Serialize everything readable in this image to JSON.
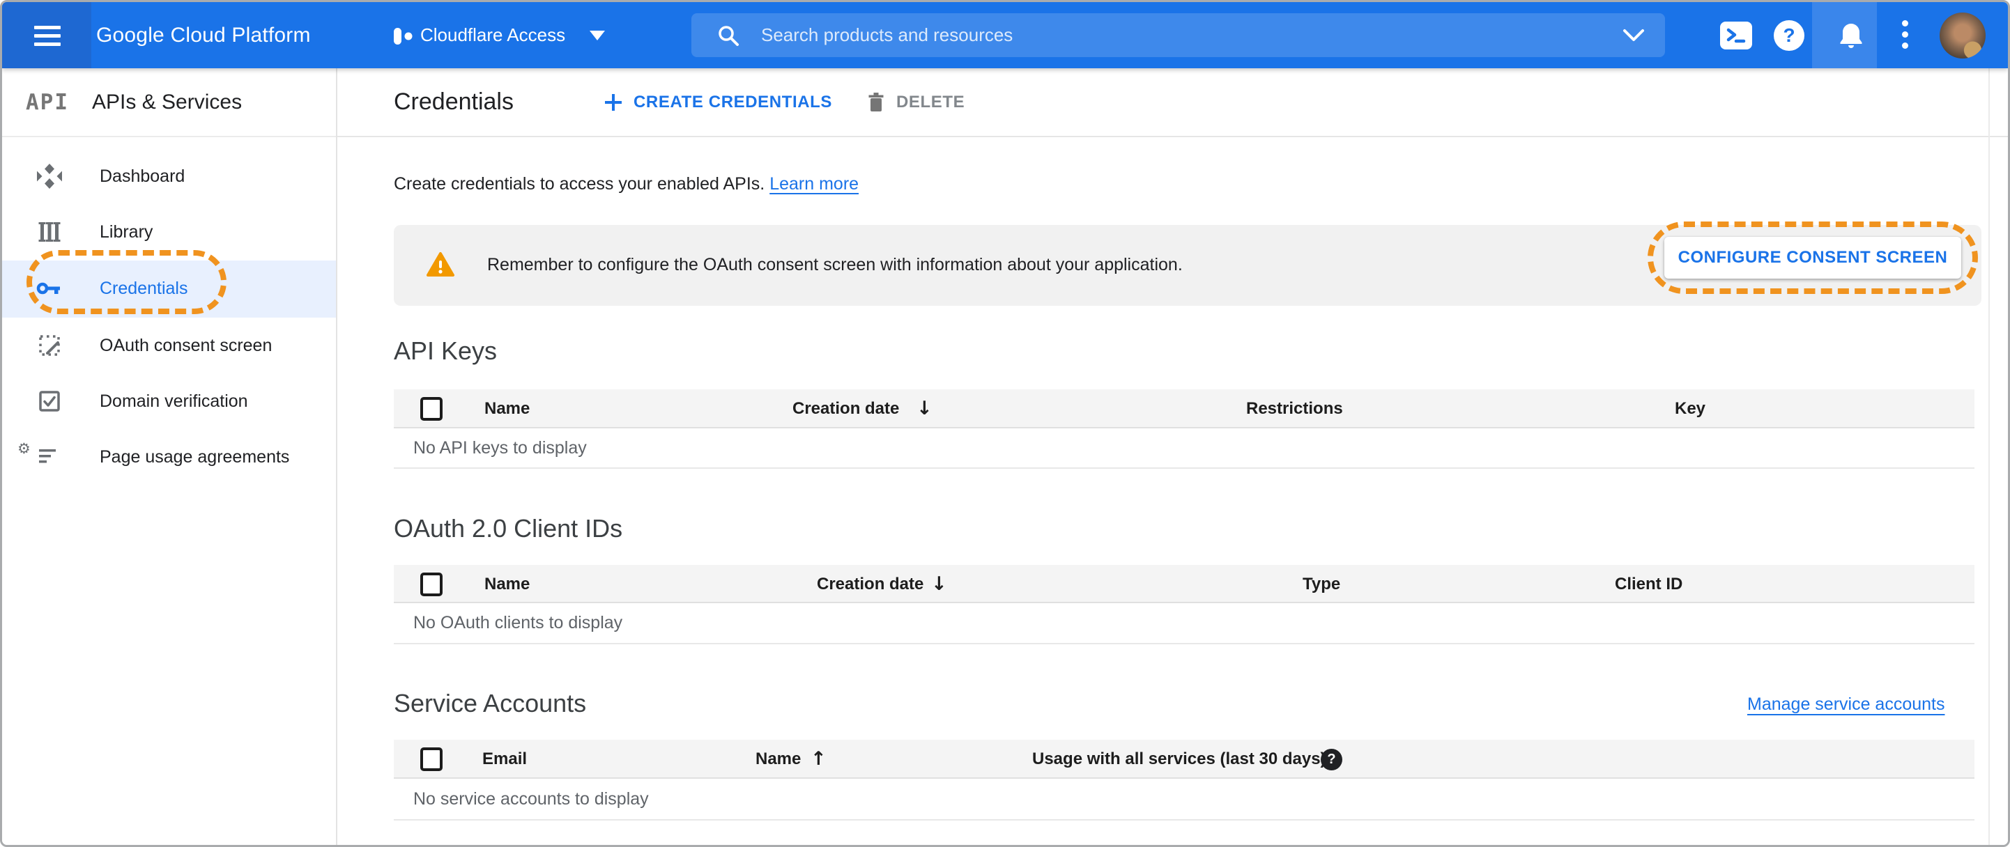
{
  "topbar": {
    "product_name": "Google Cloud Platform",
    "project_selector": {
      "label": "Cloudflare Access"
    },
    "search": {
      "placeholder": "Search products and resources"
    }
  },
  "sidebar": {
    "logo_text": "API",
    "product_title": "APIs & Services",
    "items": [
      {
        "label": "Dashboard",
        "icon": "dashboard-icon",
        "active": false
      },
      {
        "label": "Library",
        "icon": "library-icon",
        "active": false
      },
      {
        "label": "Credentials",
        "icon": "key-icon",
        "active": true,
        "annotated": true
      },
      {
        "label": "OAuth consent screen",
        "icon": "consent-screen-icon",
        "active": false
      },
      {
        "label": "Domain verification",
        "icon": "domain-verification-icon",
        "active": false
      },
      {
        "label": "Page usage agreements",
        "icon": "page-usage-icon",
        "active": false
      }
    ]
  },
  "toolbar": {
    "title": "Credentials",
    "create_label": "CREATE CREDENTIALS",
    "delete_label": "DELETE"
  },
  "intro": {
    "text": "Create credentials to access your enabled APIs.",
    "link_label": "Learn more"
  },
  "consent_banner": {
    "message": "Remember to configure the OAuth consent screen with information about your application.",
    "button_label": "CONFIGURE CONSENT SCREEN"
  },
  "sections": {
    "api_keys": {
      "title": "API Keys",
      "columns": [
        "Name",
        "Creation date",
        "Restrictions",
        "Key"
      ],
      "sort": {
        "column": "Creation date",
        "direction": "desc",
        "icon": "↓"
      },
      "empty_text": "No API keys to display"
    },
    "oauth_clients": {
      "title": "OAuth 2.0 Client IDs",
      "columns": [
        "Name",
        "Creation date",
        "Type",
        "Client ID"
      ],
      "sort": {
        "column": "Creation date",
        "direction": "desc",
        "icon": "↓"
      },
      "empty_text": "No OAuth clients to display"
    },
    "service_accounts": {
      "title": "Service Accounts",
      "manage_link": "Manage service accounts",
      "columns": [
        "Email",
        "Name",
        "Usage with all services (last 30 days)"
      ],
      "sort": {
        "column": "Name",
        "direction": "asc",
        "icon": "↑"
      },
      "help_icon": "?",
      "empty_text": "No service accounts to display"
    }
  },
  "colors": {
    "accent": "#1a73e8",
    "topbar_bg": "#1a73e8",
    "active_item_bg": "#e8f0fe",
    "annotation_orange": "#f0931f",
    "warning_orange": "#f29900",
    "banner_bg": "#f1f1f1"
  }
}
